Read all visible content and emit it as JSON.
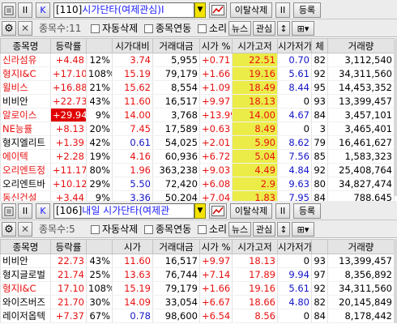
{
  "panel1": {
    "code": "[110]",
    "name": "시가단타(여제관심)Ⅰ",
    "buttons": {
      "k": "K",
      "pause": "II",
      "unwatch": "이탈삭제",
      "register": "등록"
    },
    "count_label": "종목수:11",
    "options": [
      "자동삭제",
      "종목연동",
      "소리"
    ],
    "tabs": [
      "뉴스",
      "관심"
    ],
    "headers": [
      "종목명",
      "등락률",
      "",
      "시가대비",
      "거래대금",
      "시가 %",
      "시가고저",
      "시가저가",
      "체",
      "거래량"
    ],
    "rows": [
      {
        "name": "신라섬유",
        "rate": "+4.48",
        "pct": "12%",
        "vs_open": "3.74",
        "amount": "5,955",
        "open_pct": "+0.71",
        "hl": "22.51",
        "lo": "0.70",
        "c": "82",
        "vol": "3,112,540",
        "name_color": "red",
        "rate_color": "red",
        "vs_color": "red",
        "open_color": "red",
        "hl_color": "red",
        "lo_color": "blue"
      },
      {
        "name": "형지I&C",
        "rate": "+17.10",
        "pct": "108%",
        "vs_open": "15.19",
        "amount": "79,179",
        "open_pct": "+1.66",
        "hl": "19.16",
        "lo": "5.61",
        "c": "92",
        "vol": "34,311,560",
        "name_color": "red",
        "rate_color": "red",
        "vs_color": "red",
        "open_color": "red",
        "hl_color": "red",
        "lo_color": "blue"
      },
      {
        "name": "윌비스",
        "rate": "+16.88",
        "pct": "21%",
        "vs_open": "15.62",
        "amount": "8,554",
        "open_pct": "+1.09",
        "hl": "18.49",
        "lo": "8.44",
        "c": "95",
        "vol": "14,453,352",
        "name_color": "red",
        "rate_color": "red",
        "vs_color": "red",
        "open_color": "red",
        "hl_color": "red",
        "lo_color": "blue"
      },
      {
        "name": "비비안",
        "rate": "+22.73",
        "pct": "43%",
        "vs_open": "11.60",
        "amount": "16,517",
        "open_pct": "+9.97",
        "hl": "18.13",
        "lo": "0",
        "c": "93",
        "vol": "13,399,457",
        "name_color": "black",
        "rate_color": "red",
        "vs_color": "red",
        "open_color": "red",
        "hl_color": "red",
        "lo_color": "black"
      },
      {
        "name": "알로이스",
        "rate": "+29.94",
        "pct": "9%",
        "vs_open": "14.00",
        "amount": "3,768",
        "open_pct": "+13.99",
        "hl": "14.00",
        "lo": "4.67",
        "c": "84",
        "vol": "3,457,101",
        "name_color": "red",
        "rate_color": "neg",
        "vs_color": "red",
        "open_color": "red",
        "hl_color": "red",
        "lo_color": "blue"
      },
      {
        "name": "NE능률",
        "rate": "+8.13",
        "pct": "20%",
        "vs_open": "7.45",
        "amount": "17,589",
        "open_pct": "+0.63",
        "hl": "8.49",
        "lo": "0",
        "c": "3",
        "vol": "3,465,401",
        "name_color": "red",
        "rate_color": "red",
        "vs_color": "red",
        "open_color": "red",
        "hl_color": "red",
        "lo_color": "black"
      },
      {
        "name": "형지엘리트",
        "rate": "+1.39",
        "pct": "42%",
        "vs_open": "0.61",
        "amount": "54,025",
        "open_pct": "+2.01",
        "hl": "5.90",
        "lo": "8.62",
        "c": "79",
        "vol": "16,461,627",
        "name_color": "black",
        "rate_color": "red",
        "vs_color": "blue",
        "open_color": "red",
        "hl_color": "red",
        "lo_color": "blue"
      },
      {
        "name": "에이텍",
        "rate": "+2.28",
        "pct": "19%",
        "vs_open": "4.16",
        "amount": "60,936",
        "open_pct": "+6.72",
        "hl": "5.04",
        "lo": "7.56",
        "c": "85",
        "vol": "1,583,323",
        "name_color": "red",
        "rate_color": "red",
        "vs_color": "red",
        "open_color": "red",
        "hl_color": "red",
        "lo_color": "blue"
      },
      {
        "name": "오리엔트정",
        "rate": "+11.17",
        "pct": "80%",
        "vs_open": "1.96",
        "amount": "363,238",
        "open_pct": "+9.03",
        "hl": "4.49",
        "lo": "4.84",
        "c": "92",
        "vol": "25,408,764",
        "name_color": "red",
        "rate_color": "red",
        "vs_color": "red",
        "open_color": "red",
        "hl_color": "red",
        "lo_color": "blue"
      },
      {
        "name": "오리엔트바",
        "rate": "+10.12",
        "pct": "29%",
        "vs_open": "5.50",
        "amount": "72,420",
        "open_pct": "+6.08",
        "hl": "2.9",
        "lo": "9.63",
        "c": "80",
        "vol": "34,827,474",
        "name_color": "black",
        "rate_color": "red",
        "vs_color": "blue",
        "open_color": "red",
        "hl_color": "red",
        "lo_color": "blue"
      },
      {
        "name": "동신건설",
        "rate": "+3.44",
        "pct": "9%",
        "vs_open": "3.36",
        "amount": "50,204",
        "open_pct": "+7.04",
        "hl": "1.83",
        "lo": "7.95",
        "c": "84",
        "vol": "788,645",
        "name_color": "red",
        "rate_color": "red",
        "vs_color": "blue",
        "open_color": "red",
        "hl_color": "red",
        "lo_color": "blue"
      }
    ]
  },
  "panel2": {
    "code": "[106]",
    "name": "내일 시가단타(여제관",
    "buttons": {
      "k": "K",
      "pause": "II",
      "unwatch": "이탈삭제",
      "register": "등록"
    },
    "count_label": "종목수:5",
    "options": [
      "자동삭제",
      "종목연동",
      "소리"
    ],
    "tabs": [
      "뉴스",
      "관심"
    ],
    "headers": [
      "종목명",
      "등락률",
      "",
      "시가",
      "거래대금",
      "시가 %",
      "시가고저",
      "시가저가",
      "",
      "거래량"
    ],
    "rows": [
      {
        "name": "비비안",
        "rate": "22.73",
        "pct": "43%",
        "vs_open": "11.60",
        "amount": "16,517",
        "open_pct": "+9.97",
        "hl": "18.13",
        "lo": "0",
        "c": "93",
        "vol": "13,399,457",
        "name_color": "black",
        "rate_color": "red",
        "vs_color": "red",
        "open_color": "red",
        "hl_color": "red",
        "lo_color": "black"
      },
      {
        "name": "형지글로벌",
        "rate": "21.74",
        "pct": "25%",
        "vs_open": "13.63",
        "amount": "76,744",
        "open_pct": "+7.14",
        "hl": "17.89",
        "lo": "9.94",
        "c": "97",
        "vol": "8,356,892",
        "name_color": "black",
        "rate_color": "red",
        "vs_color": "red",
        "open_color": "red",
        "hl_color": "red",
        "lo_color": "blue"
      },
      {
        "name": "형지I&C",
        "rate": "17.10",
        "pct": "108%",
        "vs_open": "15.19",
        "amount": "79,179",
        "open_pct": "+1.66",
        "hl": "19.16",
        "lo": "5.61",
        "c": "92",
        "vol": "34,311,560",
        "name_color": "red",
        "rate_color": "red",
        "vs_color": "red",
        "open_color": "red",
        "hl_color": "red",
        "lo_color": "blue"
      },
      {
        "name": "와이즈버즈",
        "rate": "21.70",
        "pct": "30%",
        "vs_open": "14.09",
        "amount": "33,054",
        "open_pct": "+6.67",
        "hl": "18.66",
        "lo": "4.80",
        "c": "82",
        "vol": "20,145,849",
        "name_color": "black",
        "rate_color": "red",
        "vs_color": "red",
        "open_color": "red",
        "hl_color": "red",
        "lo_color": "blue"
      },
      {
        "name": "레이저옵텍",
        "rate": "+7.37",
        "pct": "67%",
        "vs_open": "0.78",
        "amount": "98,600",
        "open_pct": "+6.54",
        "hl": "8.56",
        "lo": "0",
        "c": "84",
        "vol": "8,178,442",
        "name_color": "black",
        "rate_color": "red",
        "vs_color": "blue",
        "open_color": "red",
        "hl_color": "red",
        "lo_color": "black"
      }
    ]
  },
  "colors": {
    "red": "#e81010",
    "blue": "#1414c8",
    "highlight": "#ecec48",
    "header_bg": "#e4e4e4",
    "neg_bg": "#e00000"
  }
}
